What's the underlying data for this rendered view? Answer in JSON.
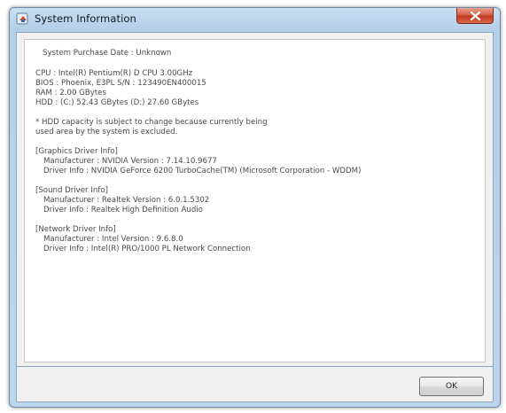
{
  "window": {
    "title": "System Information"
  },
  "info": {
    "purchase_date": "System Purchase Date : Unknown",
    "cpu": "CPU : Intel(R) Pentium(R) D CPU 3.00GHz",
    "bios": "BIOS : Phoenix, E3PL   S/N : 123490EN400015",
    "ram": "RAM : 2.00 GBytes",
    "hdd": "HDD : (C:) 52.43 GBytes (D:) 27.60 GBytes",
    "hdd_note_1": "* HDD capacity is subject to change because currently being",
    "hdd_note_2": "used area by the system is excluded."
  },
  "graphics": {
    "header": "[Graphics Driver Info]",
    "manufacturer": "Manufacturer : NVIDIA    Version : 7.14.10.9677",
    "driver": "Driver Info : NVIDIA GeForce 6200 TurboCache(TM) (Microsoft Corporation - WDDM)"
  },
  "sound": {
    "header": "[Sound Driver Info]",
    "manufacturer": "Manufacturer : Realtek    Version : 6.0.1.5302",
    "driver": "Driver Info : Realtek High Definition Audio"
  },
  "network": {
    "header": "[Network Driver Info]",
    "manufacturer": "Manufacturer : Intel    Version : 9.6.8.0",
    "driver": "Driver Info : Intel(R) PRO/1000 PL Network Connection"
  },
  "footer": {
    "ok_label": "OK"
  },
  "colors": {
    "title_bar": "#b4cfe8",
    "close_button": "#c23a20"
  }
}
